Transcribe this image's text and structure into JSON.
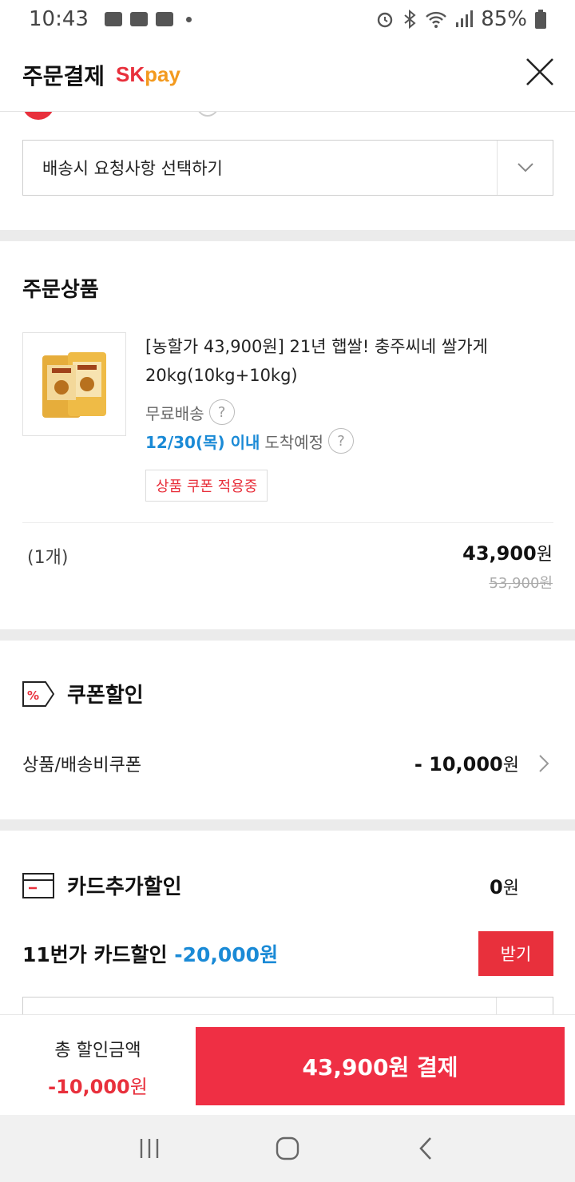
{
  "status_bar": {
    "time": "10:43",
    "battery": "85%"
  },
  "header": {
    "title": "주문결제",
    "brand_sk": "SK",
    "brand_pay": "pay"
  },
  "delivery_request": {
    "placeholder": "배송시 요청사항 선택하기"
  },
  "order_items": {
    "title": "주문상품",
    "product": {
      "name": "[농할가 43,900원] 21년 햅쌀! 충주씨네 쌀가게 20kg(10kg+10kg)",
      "shipping": "무료배송",
      "arrival_date": "12/30(목) 이내",
      "arrival_text": "도착예정",
      "coupon_tag": "상품 쿠폰 적용중",
      "quantity": "(1개)",
      "price": "43,900",
      "price_unit": "원",
      "original_price": "53,900원"
    }
  },
  "coupon": {
    "title": "쿠폰할인",
    "label": "상품/배송비쿠폰",
    "value": "- 10,000",
    "unit": "원"
  },
  "card_discount": {
    "title": "카드추가할인",
    "value": "0",
    "unit": "원",
    "offer_label": "11번가 카드할인",
    "offer_amount": "-20,000원",
    "get_button": "받기"
  },
  "bottom": {
    "total_label": "총 할인금액",
    "total_value": "-10,000",
    "total_unit": "원",
    "pay_button": "43,900원 결제"
  },
  "colors": {
    "accent_red": "#e8303c",
    "accent_blue": "#1a8ad6",
    "pay_orange": "#f39a1f"
  }
}
